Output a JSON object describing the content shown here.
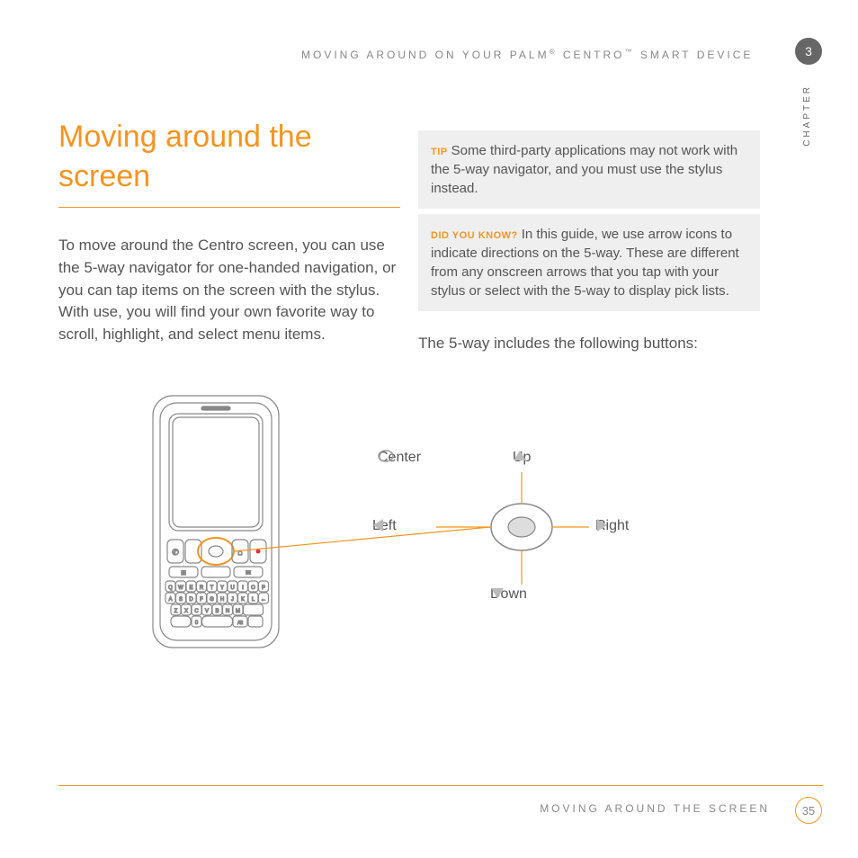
{
  "header": {
    "breadcrumb_pre": "MOVING AROUND ON YOUR PALM",
    "breadcrumb_mid": " CENTRO",
    "breadcrumb_post": " SMART DEVICE",
    "chapter_number": "3",
    "chapter_label": "CHAPTER"
  },
  "title": "Moving around the screen",
  "intro": "To move around the Centro screen, you can use the 5-way navigator for one-handed navigation, or you can tap items on the screen with the stylus. With use, you will find your own favorite way to scroll, highlight, and select menu items.",
  "tip": {
    "label": "TIP",
    "text": "Some third-party applications may not work with the 5-way navigator, and you must use the stylus instead."
  },
  "dyk": {
    "label": "DID YOU KNOW?",
    "text": "In this guide, we use arrow icons to indicate directions on the 5-way. These are different from any onscreen arrows that you tap with your stylus or select with the 5-way to display pick lists."
  },
  "lead_out": "The 5-way includes the following buttons:",
  "labels": {
    "center": "Center",
    "up": "Up",
    "left": "Left",
    "right": "Right",
    "down": "Down"
  },
  "keyboard_rows": [
    [
      "Q",
      "W",
      "E",
      "R",
      "T",
      "Y",
      "U",
      "I",
      "O",
      "P"
    ],
    [
      "A",
      "S",
      "D",
      "F",
      "G",
      "H",
      "J",
      "K",
      "L",
      "←"
    ],
    [
      "Z",
      "X",
      "C",
      "V",
      "B",
      "N",
      "M",
      "",
      "",
      ""
    ],
    [
      "",
      "0",
      "",
      "",
      "",
      "Alt",
      "",
      "",
      "",
      ""
    ]
  ],
  "footer": {
    "section": "MOVING AROUND THE SCREEN",
    "page": "35"
  }
}
